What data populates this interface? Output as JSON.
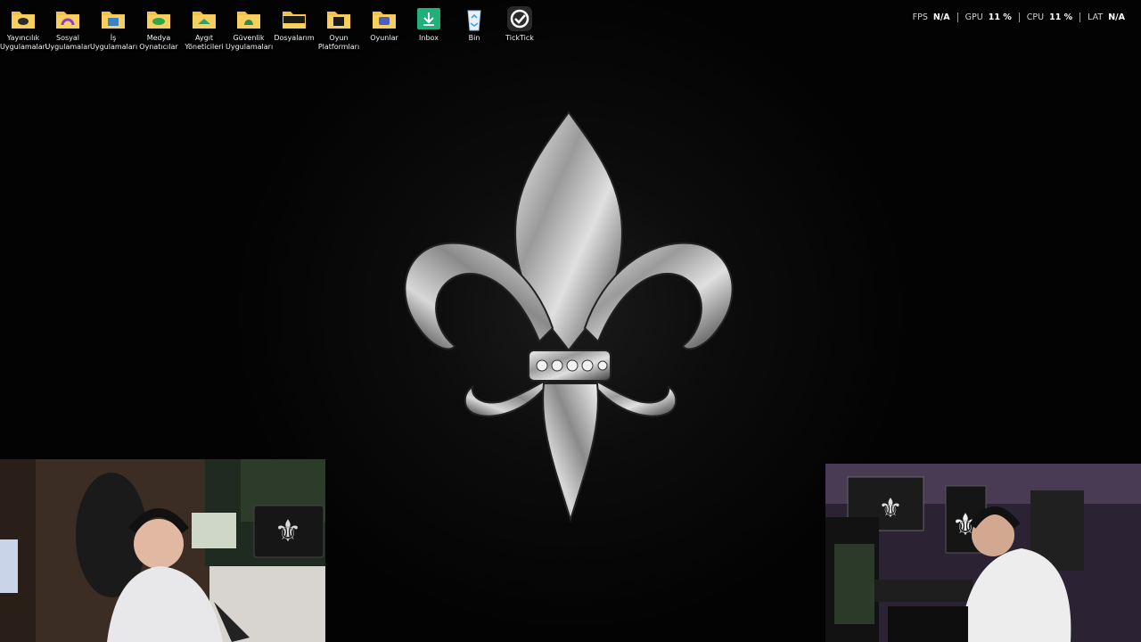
{
  "desktop": {
    "icons": [
      {
        "id": "yayincilik",
        "name": "Yayıncılık Uygulamaları",
        "icon": "folder-icon",
        "accent": "#2b2b2b"
      },
      {
        "id": "sosyal",
        "name": "Sosyal Uygulamalar",
        "icon": "folder-icon",
        "accent": "#8e3bd9"
      },
      {
        "id": "is",
        "name": "İş Uygulamaları",
        "icon": "folder-icon",
        "accent": "#3b82c4"
      },
      {
        "id": "medya",
        "name": "Medya Oynatıcılar",
        "icon": "folder-icon",
        "accent": "#2ea84a"
      },
      {
        "id": "aygit",
        "name": "Aygıt Yöneticileri",
        "icon": "folder-icon",
        "accent": "#3c9b6a"
      },
      {
        "id": "guvenlik",
        "name": "Güvenlik Uygulamaları",
        "icon": "folder-icon",
        "accent": "#2f8c4e"
      },
      {
        "id": "dosyalarim",
        "name": "Dosyalarım",
        "icon": "folder-icon",
        "accent": "#1a1a1a"
      },
      {
        "id": "oyun-platformlari",
        "name": "Oyun Platformları",
        "icon": "folder-icon",
        "accent": "#1a1a1a"
      },
      {
        "id": "oyunlar",
        "name": "Oyunlar",
        "icon": "folder-icon",
        "accent": "#4b5fc4"
      },
      {
        "id": "inbox",
        "name": "Inbox",
        "icon": "download-icon",
        "accent": "#22b07a"
      },
      {
        "id": "bin",
        "name": "Bin",
        "icon": "recycle-bin-icon",
        "accent": "#4aa0e0"
      },
      {
        "id": "ticktick",
        "name": "TickTick",
        "icon": "ticktick-icon",
        "accent": "#2a2a2a"
      }
    ]
  },
  "overlay": {
    "stats": [
      {
        "key": "FPS",
        "value": "N/A"
      },
      {
        "key": "GPU",
        "value": "11 %"
      },
      {
        "key": "CPU",
        "value": "11 %"
      },
      {
        "key": "LAT",
        "value": "N/A"
      }
    ]
  },
  "wallpaper": {
    "subject": "fleur-de-lis-icon",
    "color": "#bfbfbf"
  },
  "webcams": [
    {
      "id": "left",
      "subject": "streamer camera"
    },
    {
      "id": "right",
      "subject": "streamer camera"
    }
  ]
}
